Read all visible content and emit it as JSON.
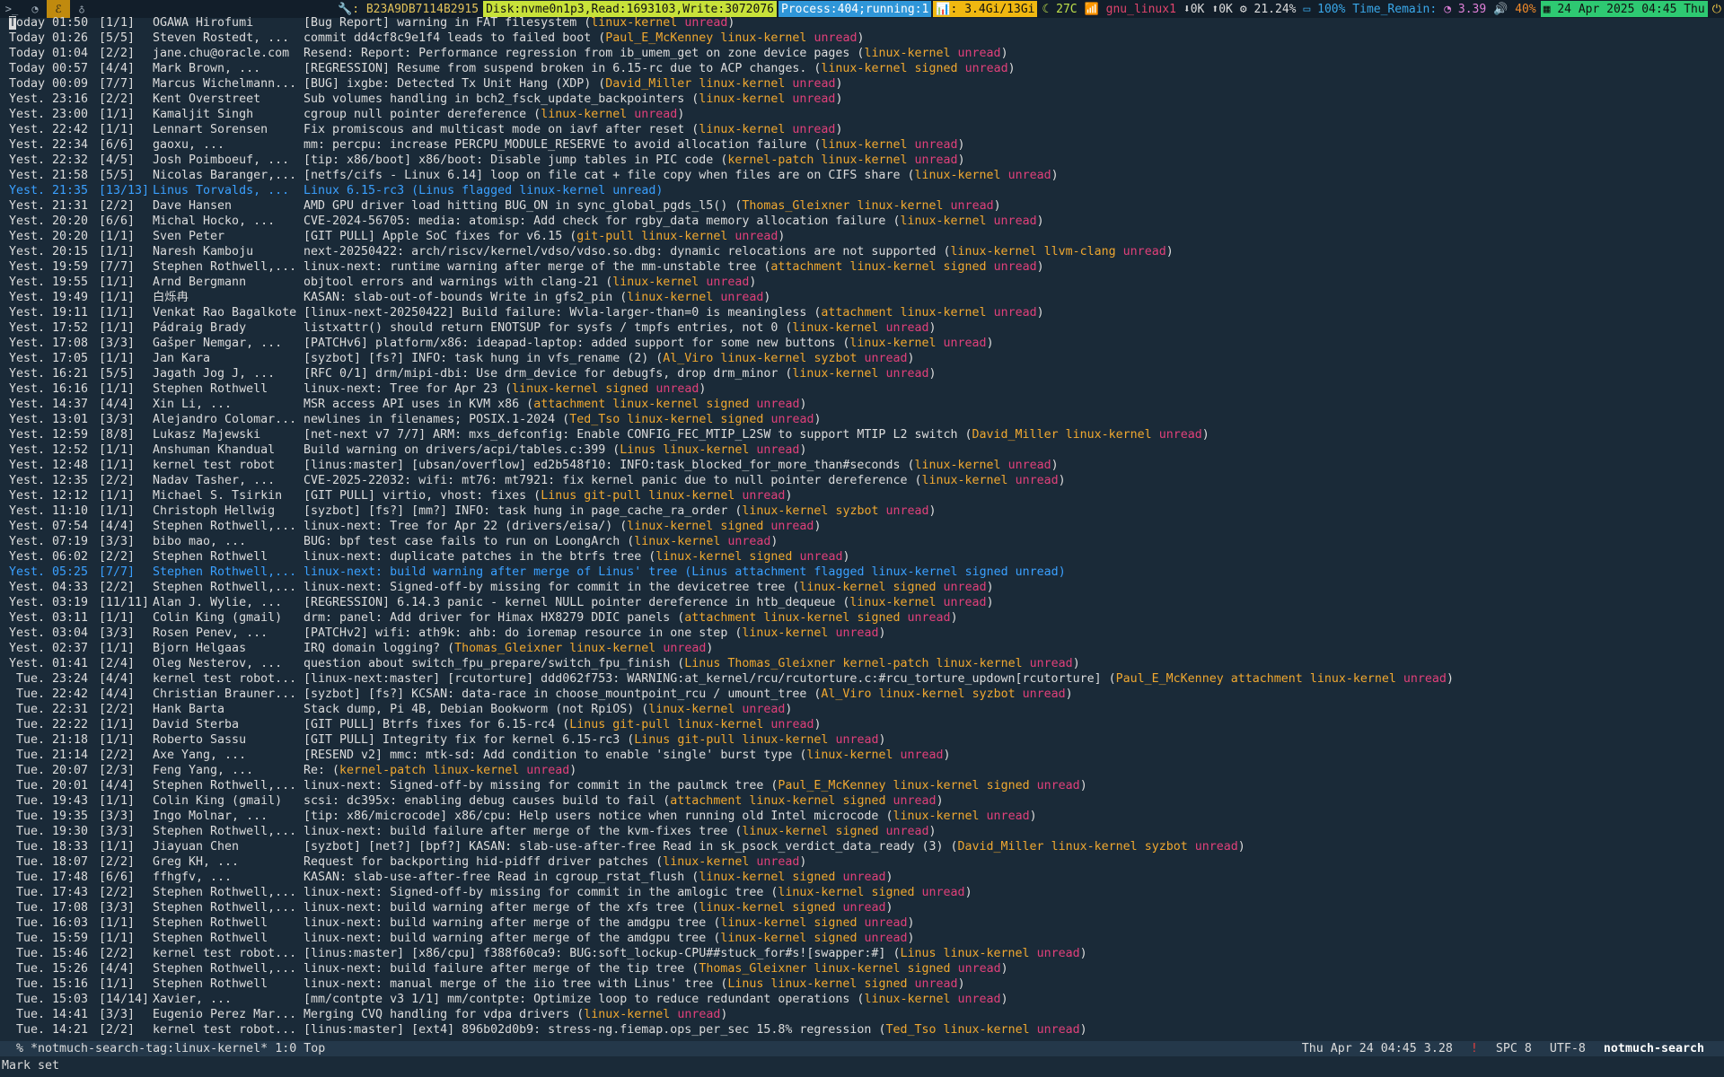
{
  "topbar": {
    "workspaces": [
      {
        "label": ">_",
        "icon": "terminal-icon",
        "active": false
      },
      {
        "label": "◔",
        "icon": "browser-icon",
        "active": false
      },
      {
        "label": "ℰ",
        "icon": "emacs-icon",
        "active": true
      },
      {
        "label": "♁",
        "icon": "tux-icon",
        "active": false
      }
    ],
    "disk_id": "🔧: B23A9DB7114B2915",
    "disk": "Disk:nvme0n1p3,Read:1693103,Write:3072076",
    "process": "Process:404;running:1",
    "memory": "📊: 3.4Gi/13Gi",
    "temp": "☾ 27C",
    "net_name": "📶 gnu_linux1",
    "net_down": "⬇0K",
    "net_up": "⬆0K",
    "cpu": "⚙ 21.24%",
    "battery": "▭ 100% Time_Remain:",
    "load": "◔ 3.39",
    "volume": "🔊 40%",
    "datetime": "▦ 24 Apr 2025 04:45 Thu",
    "power_icon": "power-icon"
  },
  "rows": [
    {
      "date": "Today 01:50",
      "count": "[1/1]",
      "author": "OGAWA Hirofumi",
      "subject": "[Bug Report] warning in FAT filesystem",
      "tags": [
        "linux-kernel"
      ],
      "cursor": true
    },
    {
      "date": "Today 01:26",
      "count": "[5/5]",
      "author": "Steven Rostedt, ...",
      "subject": "commit dd4cf8c9e1f4 leads to failed boot",
      "tags": [
        "Paul_E_McKenney",
        "linux-kernel"
      ]
    },
    {
      "date": "Today 01:04",
      "count": "[2/2]",
      "author": "jane.chu@oracle.com",
      "subject": "Resend: Report: Performance regression from ib_umem_get on zone device pages",
      "tags": [
        "linux-kernel"
      ]
    },
    {
      "date": "Today 00:57",
      "count": "[4/4]",
      "author": "Mark Brown, ...",
      "subject": "[REGRESSION] Resume from suspend broken in 6.15-rc due to ACP changes.",
      "tags": [
        "linux-kernel",
        "signed"
      ]
    },
    {
      "date": "Today 00:09",
      "count": "[7/7]",
      "author": "Marcus Wichelmann...",
      "subject": "[BUG] ixgbe: Detected Tx Unit Hang (XDP)",
      "tags": [
        "David_Miller",
        "linux-kernel"
      ]
    },
    {
      "date": "Yest. 23:16",
      "count": "[2/2]",
      "author": "Kent Overstreet",
      "subject": "Sub volumes handling in bch2_fsck_update_backpointers",
      "tags": [
        "linux-kernel"
      ]
    },
    {
      "date": "Yest. 23:00",
      "count": "[1/1]",
      "author": "Kamaljit Singh",
      "subject": "cgroup null pointer dereference",
      "tags": [
        "linux-kernel"
      ]
    },
    {
      "date": "Yest. 22:42",
      "count": "[1/1]",
      "author": "Lennart Sorensen",
      "subject": "Fix promiscous and multicast mode on iavf after reset",
      "tags": [
        "linux-kernel"
      ]
    },
    {
      "date": "Yest. 22:34",
      "count": "[6/6]",
      "author": "gaoxu, ...",
      "subject": "mm: percpu: increase PERCPU_MODULE_RESERVE to avoid allocation failure",
      "tags": [
        "linux-kernel"
      ]
    },
    {
      "date": "Yest. 22:32",
      "count": "[4/5]",
      "author": "Josh Poimboeuf, ...",
      "subject": "[tip: x86/boot] x86/boot: Disable jump tables in PIC code",
      "tags": [
        "kernel-patch",
        "linux-kernel"
      ]
    },
    {
      "date": "Yest. 21:58",
      "count": "[5/5]",
      "author": "Nicolas Baranger,...",
      "subject": "[netfs/cifs - Linux 6.14] loop on file cat + file copy when files are on CIFS share",
      "tags": [
        "linux-kernel"
      ]
    },
    {
      "date": "Yest. 21:35",
      "count": "[13/13]",
      "author": "Linus Torvalds, ...",
      "subject": "Linux 6.15-rc3",
      "tags": [
        "Linus",
        "flagged",
        "linux-kernel"
      ],
      "flagged": true
    },
    {
      "date": "Yest. 21:31",
      "count": "[2/2]",
      "author": "Dave Hansen",
      "subject": "AMD GPU driver load hitting BUG_ON in sync_global_pgds_l5()",
      "tags": [
        "Thomas_Gleixner",
        "linux-kernel"
      ]
    },
    {
      "date": "Yest. 20:20",
      "count": "[6/6]",
      "author": "Michal Hocko, ...",
      "subject": "CVE-2024-56705: media: atomisp: Add check for rgby_data memory allocation failure",
      "tags": [
        "linux-kernel"
      ]
    },
    {
      "date": "Yest. 20:20",
      "count": "[1/1]",
      "author": "Sven Peter",
      "subject": "[GIT PULL] Apple SoC fixes for v6.15",
      "tags": [
        "git-pull",
        "linux-kernel"
      ]
    },
    {
      "date": "Yest. 20:15",
      "count": "[1/1]",
      "author": "Naresh Kamboju",
      "subject": "next-20250422: arch/riscv/kernel/vdso/vdso.so.dbg: dynamic relocations are not supported",
      "tags": [
        "linux-kernel",
        "llvm-clang"
      ]
    },
    {
      "date": "Yest. 19:59",
      "count": "[7/7]",
      "author": "Stephen Rothwell,...",
      "subject": "linux-next: runtime warning after merge of the mm-unstable tree",
      "tags": [
        "attachment",
        "linux-kernel",
        "signed"
      ]
    },
    {
      "date": "Yest. 19:55",
      "count": "[1/1]",
      "author": "Arnd Bergmann",
      "subject": "objtool errors and warnings with clang-21",
      "tags": [
        "linux-kernel"
      ]
    },
    {
      "date": "Yest. 19:49",
      "count": "[1/1]",
      "author": "白烁冉",
      "subject": "KASAN: slab-out-of-bounds Write in gfs2_pin",
      "tags": [
        "linux-kernel"
      ]
    },
    {
      "date": "Yest. 19:11",
      "count": "[1/1]",
      "author": "Venkat Rao Bagalkote",
      "subject": "[linux-next-20250422] Build failure: Wvla-larger-than=0 is meaningless",
      "tags": [
        "attachment",
        "linux-kernel"
      ]
    },
    {
      "date": "Yest. 17:52",
      "count": "[1/1]",
      "author": "Pádraig Brady",
      "subject": "listxattr() should return ENOTSUP for sysfs / tmpfs entries, not 0",
      "tags": [
        "linux-kernel"
      ]
    },
    {
      "date": "Yest. 17:08",
      "count": "[3/3]",
      "author": "Gašper Nemgar, ...",
      "subject": "[PATCHv6] platform/x86: ideapad-laptop: added support for some new buttons",
      "tags": [
        "linux-kernel"
      ]
    },
    {
      "date": "Yest. 17:05",
      "count": "[1/1]",
      "author": "Jan Kara",
      "subject": "[syzbot] [fs?] INFO: task hung in vfs_rename (2)",
      "tags": [
        "Al_Viro",
        "linux-kernel",
        "syzbot"
      ]
    },
    {
      "date": "Yest. 16:21",
      "count": "[5/5]",
      "author": "Jagath Jog J, ...",
      "subject": "[RFC 0/1] drm/mipi-dbi: Use drm_device for debugfs, drop drm_minor",
      "tags": [
        "linux-kernel"
      ]
    },
    {
      "date": "Yest. 16:16",
      "count": "[1/1]",
      "author": "Stephen Rothwell",
      "subject": "linux-next: Tree for Apr 23",
      "tags": [
        "linux-kernel",
        "signed"
      ]
    },
    {
      "date": "Yest. 14:37",
      "count": "[4/4]",
      "author": "Xin Li, ...",
      "subject": "MSR access API uses in KVM x86",
      "tags": [
        "attachment",
        "linux-kernel",
        "signed"
      ]
    },
    {
      "date": "Yest. 13:01",
      "count": "[3/3]",
      "author": "Alejandro Colomar...",
      "subject": "newlines in filenames; POSIX.1-2024",
      "tags": [
        "Ted_Tso",
        "linux-kernel",
        "signed"
      ]
    },
    {
      "date": "Yest. 12:59",
      "count": "[8/8]",
      "author": "Lukasz Majewski",
      "subject": "[net-next v7 7/7] ARM: mxs_defconfig: Enable CONFIG_FEC_MTIP_L2SW to support MTIP L2 switch",
      "tags": [
        "David_Miller",
        "linux-kernel"
      ]
    },
    {
      "date": "Yest. 12:52",
      "count": "[1/1]",
      "author": "Anshuman Khandual",
      "subject": "Build warning on drivers/acpi/tables.c:399",
      "tags": [
        "Linus",
        "linux-kernel"
      ]
    },
    {
      "date": "Yest. 12:48",
      "count": "[1/1]",
      "author": "kernel test robot",
      "subject": "[linus:master] [ubsan/overflow]  ed2b548f10: INFO:task_blocked_for_more_than#seconds",
      "tags": [
        "linux-kernel"
      ]
    },
    {
      "date": "Yest. 12:35",
      "count": "[2/2]",
      "author": "Nadav Tasher, ...",
      "subject": "CVE-2025-22032: wifi: mt76: mt7921: fix kernel panic due to null pointer dereference",
      "tags": [
        "linux-kernel"
      ]
    },
    {
      "date": "Yest. 12:12",
      "count": "[1/1]",
      "author": "Michael S. Tsirkin",
      "subject": "[GIT PULL] virtio, vhost: fixes",
      "tags": [
        "Linus",
        "git-pull",
        "linux-kernel"
      ]
    },
    {
      "date": "Yest. 11:10",
      "count": "[1/1]",
      "author": "Christoph Hellwig",
      "subject": "[syzbot] [fs?] [mm?] INFO: task hung in page_cache_ra_order",
      "tags": [
        "linux-kernel",
        "syzbot"
      ]
    },
    {
      "date": "Yest. 07:54",
      "count": "[4/4]",
      "author": "Stephen Rothwell,...",
      "subject": "linux-next: Tree for Apr 22 (drivers/eisa/)",
      "tags": [
        "linux-kernel",
        "signed"
      ]
    },
    {
      "date": "Yest. 07:19",
      "count": "[3/3]",
      "author": "bibo mao, ...",
      "subject": "BUG: bpf test case fails to run on LoongArch",
      "tags": [
        "linux-kernel"
      ]
    },
    {
      "date": "Yest. 06:02",
      "count": "[2/2]",
      "author": "Stephen Rothwell",
      "subject": "linux-next: duplicate patches in the btrfs tree",
      "tags": [
        "linux-kernel",
        "signed"
      ]
    },
    {
      "date": "Yest. 05:25",
      "count": "[7/7]",
      "author": "Stephen Rothwell,...",
      "subject": "linux-next: build warning after merge of Linus' tree",
      "tags": [
        "Linus",
        "attachment",
        "flagged",
        "linux-kernel",
        "signed"
      ],
      "flagged": true
    },
    {
      "date": "Yest. 04:33",
      "count": "[2/2]",
      "author": "Stephen Rothwell,...",
      "subject": "linux-next: Signed-off-by missing for commit in the devicetree tree",
      "tags": [
        "linux-kernel",
        "signed"
      ]
    },
    {
      "date": "Yest. 03:19",
      "count": "[11/11]",
      "author": "Alan J. Wylie, ...",
      "subject": "[REGRESSION] 6.14.3 panic - kernel NULL pointer dereference in htb_dequeue",
      "tags": [
        "linux-kernel"
      ]
    },
    {
      "date": "Yest. 03:11",
      "count": "[1/1]",
      "author": "Colin King (gmail)",
      "subject": "drm: panel: Add driver for Himax HX8279 DDIC panels",
      "tags": [
        "attachment",
        "linux-kernel",
        "signed"
      ]
    },
    {
      "date": "Yest. 03:04",
      "count": "[3/3]",
      "author": "Rosen Penev, ...",
      "subject": "[PATCHv2] wifi: ath9k: ahb: do ioremap resource in one step",
      "tags": [
        "linux-kernel"
      ]
    },
    {
      "date": "Yest. 02:37",
      "count": "[1/1]",
      "author": "Bjorn Helgaas",
      "subject": "IRQ domain logging?",
      "tags": [
        "Thomas_Gleixner",
        "linux-kernel"
      ]
    },
    {
      "date": "Yest. 01:41",
      "count": "[2/4]",
      "author": "Oleg Nesterov, ...",
      "subject": "question about switch_fpu_prepare/switch_fpu_finish",
      "tags": [
        "Linus",
        "Thomas_Gleixner",
        "kernel-patch",
        "linux-kernel"
      ]
    },
    {
      "date": "Tue. 23:24",
      "count": "[4/4]",
      "author": "kernel test robot...",
      "subject": "[linux-next:master] [rcutorture]  ddd062f753: WARNING:at_kernel/rcu/rcutorture.c:#rcu_torture_updown[rcutorture]",
      "tags": [
        "Paul_E_McKenney",
        "attachment",
        "linux-kernel"
      ]
    },
    {
      "date": "Tue. 22:42",
      "count": "[4/4]",
      "author": "Christian Brauner...",
      "subject": "[syzbot] [fs?] KCSAN: data-race in choose_mountpoint_rcu / umount_tree",
      "tags": [
        "Al_Viro",
        "linux-kernel",
        "syzbot"
      ]
    },
    {
      "date": "Tue. 22:31",
      "count": "[2/2]",
      "author": "Hank Barta",
      "subject": "Stack dump, Pi 4B, Debian Bookworm (not RpiOS)",
      "tags": [
        "linux-kernel"
      ]
    },
    {
      "date": "Tue. 22:22",
      "count": "[1/1]",
      "author": "David Sterba",
      "subject": "[GIT PULL] Btrfs fixes for 6.15-rc4",
      "tags": [
        "Linus",
        "git-pull",
        "linux-kernel"
      ]
    },
    {
      "date": "Tue. 21:18",
      "count": "[1/1]",
      "author": "Roberto Sassu",
      "subject": "[GIT PULL] Integrity fix for kernel 6.15-rc3",
      "tags": [
        "Linus",
        "git-pull",
        "linux-kernel"
      ]
    },
    {
      "date": "Tue. 21:14",
      "count": "[2/2]",
      "author": "Axe Yang, ...",
      "subject": "[RESEND v2] mmc: mtk-sd: Add condition to enable 'single' burst type",
      "tags": [
        "linux-kernel"
      ]
    },
    {
      "date": "Tue. 20:07",
      "count": "[2/3]",
      "author": "Feng Yang, ...",
      "subject": "Re:",
      "tags": [
        "kernel-patch",
        "linux-kernel"
      ]
    },
    {
      "date": "Tue. 20:01",
      "count": "[4/4]",
      "author": "Stephen Rothwell,...",
      "subject": "linux-next: Signed-off-by missing for commit in the paulmck tree",
      "tags": [
        "Paul_E_McKenney",
        "linux-kernel",
        "signed"
      ]
    },
    {
      "date": "Tue. 19:43",
      "count": "[1/1]",
      "author": "Colin King (gmail)",
      "subject": "scsi: dc395x: enabling debug causes build to fail",
      "tags": [
        "attachment",
        "linux-kernel",
        "signed"
      ]
    },
    {
      "date": "Tue. 19:35",
      "count": "[3/3]",
      "author": "Ingo Molnar, ...",
      "subject": "[tip: x86/microcode] x86/cpu: Help users notice when running old Intel microcode",
      "tags": [
        "linux-kernel"
      ]
    },
    {
      "date": "Tue. 19:30",
      "count": "[3/3]",
      "author": "Stephen Rothwell,...",
      "subject": "linux-next: build failure after merge of the kvm-fixes tree",
      "tags": [
        "linux-kernel",
        "signed"
      ]
    },
    {
      "date": "Tue. 18:33",
      "count": "[1/1]",
      "author": "Jiayuan Chen",
      "subject": "[syzbot] [net?] [bpf?] KASAN: slab-use-after-free Read in sk_psock_verdict_data_ready (3)",
      "tags": [
        "David_Miller",
        "linux-kernel",
        "syzbot"
      ]
    },
    {
      "date": "Tue. 18:07",
      "count": "[2/2]",
      "author": "Greg KH, ...",
      "subject": "Request for backporting hid-pidff driver patches",
      "tags": [
        "linux-kernel"
      ]
    },
    {
      "date": "Tue. 17:48",
      "count": "[6/6]",
      "author": "ffhgfv, ...",
      "subject": "KASAN: slab-use-after-free Read in cgroup_rstat_flush",
      "tags": [
        "linux-kernel",
        "signed"
      ]
    },
    {
      "date": "Tue. 17:43",
      "count": "[2/2]",
      "author": "Stephen Rothwell,...",
      "subject": "linux-next: Signed-off-by missing for commit in the amlogic tree",
      "tags": [
        "linux-kernel",
        "signed"
      ]
    },
    {
      "date": "Tue. 17:08",
      "count": "[3/3]",
      "author": "Stephen Rothwell,...",
      "subject": "linux-next: build warning after merge of the xfs tree",
      "tags": [
        "linux-kernel",
        "signed"
      ]
    },
    {
      "date": "Tue. 16:03",
      "count": "[1/1]",
      "author": "Stephen Rothwell",
      "subject": "linux-next: build warning after merge of the amdgpu tree",
      "tags": [
        "linux-kernel",
        "signed"
      ]
    },
    {
      "date": "Tue. 15:59",
      "count": "[1/1]",
      "author": "Stephen Rothwell",
      "subject": "linux-next: build warning after merge of the amdgpu tree",
      "tags": [
        "linux-kernel",
        "signed"
      ]
    },
    {
      "date": "Tue. 15:46",
      "count": "[2/2]",
      "author": "kernel test robot...",
      "subject": "[linus:master] [x86/cpu]  f388f60ca9: BUG:soft_lockup-CPU##stuck_for#s![swapper:#]",
      "tags": [
        "Linus",
        "linux-kernel"
      ]
    },
    {
      "date": "Tue. 15:26",
      "count": "[4/4]",
      "author": "Stephen Rothwell,...",
      "subject": "linux-next: build failure after merge of the tip tree",
      "tags": [
        "Thomas_Gleixner",
        "linux-kernel",
        "signed"
      ]
    },
    {
      "date": "Tue. 15:16",
      "count": "[1/1]",
      "author": "Stephen Rothwell",
      "subject": "linux-next: manual merge of the iio tree with Linus' tree",
      "tags": [
        "Linus",
        "linux-kernel",
        "signed"
      ]
    },
    {
      "date": "Tue. 15:03",
      "count": "[14/14]",
      "author": "Xavier, ...",
      "subject": "[mm/contpte v3 1/1] mm/contpte: Optimize loop to reduce redundant operations",
      "tags": [
        "linux-kernel"
      ]
    },
    {
      "date": "Tue. 14:41",
      "count": "[3/3]",
      "author": "Eugenio Perez Mar...",
      "subject": "Merging CVQ handling for vdpa drivers",
      "tags": [
        "linux-kernel"
      ]
    },
    {
      "date": "Tue. 14:21",
      "count": "[2/2]",
      "author": "kernel test robot...",
      "subject": "[linus:master] [ext4]  896b02d0b9:  stress-ng.fiemap.ops_per_sec 15.8% regression",
      "tags": [
        "Ted_Tso",
        "linux-kernel"
      ]
    }
  ],
  "unread_tag": "unread",
  "modeline": {
    "buffer": "% *notmuch-search-tag:linux-kernel*  1:0 Top",
    "time": "Thu Apr 24 04:45 3.28",
    "warn": "!",
    "indent": "SPC 8",
    "encoding": "UTF-8",
    "mode": "notmuch-search"
  },
  "echo": "Mark set"
}
